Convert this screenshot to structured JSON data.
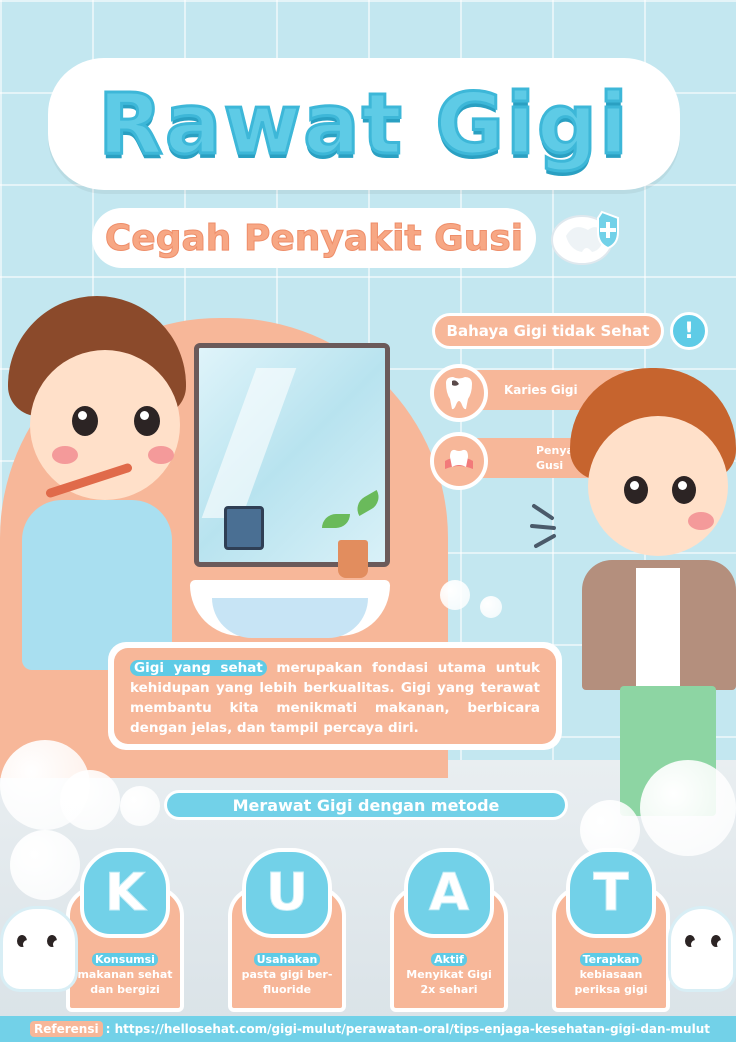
{
  "title": "Rawat Gigi",
  "subtitle": "Cegah Penyakit Gusi",
  "danger": {
    "heading": "Bahaya Gigi tidak Sehat",
    "items": [
      {
        "label": "Karies Gigi"
      },
      {
        "label": "Penyakit Gusi"
      }
    ]
  },
  "info": {
    "highlight": "Gigi yang sehat",
    "text": " merupakan fondasi utama untuk kehidupan yang lebih berkualitas. Gigi yang terawat membantu kita menikmati makanan, berbicara dengan jelas, dan tampil percaya diri."
  },
  "method_title": "Merawat Gigi dengan metode",
  "kuat": [
    {
      "letter": "K",
      "first": "Konsumsi",
      "rest": "makanan sehat dan bergizi"
    },
    {
      "letter": "U",
      "first": "Usahakan",
      "rest": "pasta gigi ber-fluoride"
    },
    {
      "letter": "A",
      "first": "Aktif",
      "rest": "Menyikat Gigi 2x sehari"
    },
    {
      "letter": "T",
      "first": "Terapkan",
      "rest": "kebiasaan periksa gigi"
    }
  ],
  "footer": {
    "label": "Referensi",
    "text": ": https://hellosehat.com/gigi-mulut/perawatan-oral/tips-enjaga-kesehatan-gigi-dan-mulut"
  },
  "colors": {
    "accent_blue": "#5ecbe6",
    "accent_peach": "#f7b799",
    "background": "#c3e7f0"
  }
}
